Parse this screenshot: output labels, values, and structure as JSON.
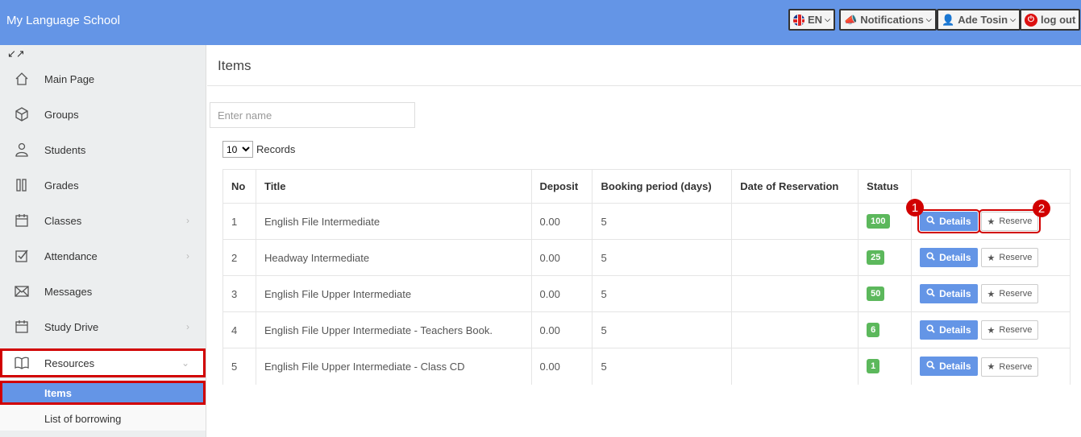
{
  "app": {
    "title": "My Language School"
  },
  "topnav": {
    "language": "EN",
    "notifications": "Notifications",
    "user": "Ade Tosin",
    "logout": "log out"
  },
  "sidebar": {
    "items": [
      {
        "label": "Main Page",
        "icon": "home-icon"
      },
      {
        "label": "Groups",
        "icon": "cube-icon"
      },
      {
        "label": "Students",
        "icon": "user-icon"
      },
      {
        "label": "Grades",
        "icon": "grades-icon"
      },
      {
        "label": "Classes",
        "icon": "calendar-icon"
      },
      {
        "label": "Attendance",
        "icon": "checkbox-icon"
      },
      {
        "label": "Messages",
        "icon": "envelope-icon"
      },
      {
        "label": "Study Drive",
        "icon": "calendar-icon"
      },
      {
        "label": "Resources",
        "icon": "book-icon"
      }
    ],
    "subitems": [
      {
        "label": "Items"
      },
      {
        "label": "List of borrowing"
      }
    ]
  },
  "main": {
    "title": "Items",
    "search_placeholder": "Enter name",
    "records_value": "10",
    "records_label": "Records",
    "columns": [
      "No",
      "Title",
      "Deposit",
      "Booking period (days)",
      "Date of Reservation",
      "Status"
    ],
    "details_label": "Details",
    "reserve_label": "Reserve",
    "rows": [
      {
        "no": "1",
        "title": "English File Intermediate",
        "deposit": "0.00",
        "period": "5",
        "date": "",
        "status": "100"
      },
      {
        "no": "2",
        "title": "Headway Intermediate",
        "deposit": "0.00",
        "period": "5",
        "date": "",
        "status": "25"
      },
      {
        "no": "3",
        "title": "English File Upper Intermediate",
        "deposit": "0.00",
        "period": "5",
        "date": "",
        "status": "50"
      },
      {
        "no": "4",
        "title": "English File Upper Intermediate - Teachers Book.",
        "deposit": "0.00",
        "period": "5",
        "date": "",
        "status": "6"
      },
      {
        "no": "5",
        "title": "English File Upper Intermediate - Class CD",
        "deposit": "0.00",
        "period": "5",
        "date": "",
        "status": "1"
      }
    ]
  },
  "annotations": {
    "marker1": "1",
    "marker2": "2"
  },
  "colors": {
    "topbar": "#6495e6",
    "status_badge": "#5cb85c",
    "highlight": "#d10000"
  }
}
